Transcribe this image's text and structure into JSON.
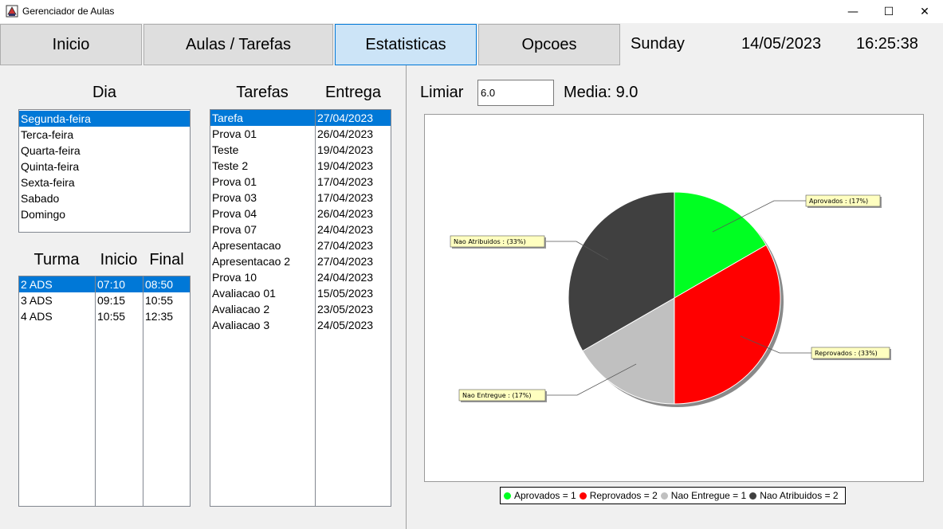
{
  "window": {
    "title": "Gerenciador de Aulas",
    "minimize": "—",
    "maximize": "☐",
    "close": "✕"
  },
  "nav": {
    "inicio": "Inicio",
    "aulas": "Aulas / Tarefas",
    "estatisticas": "Estatisticas",
    "opcoes": "Opcoes"
  },
  "status": {
    "day": "Sunday",
    "date": "14/05/2023",
    "time": "16:25:38"
  },
  "dia": {
    "header": "Dia",
    "items": [
      "Segunda-feira",
      "Terca-feira",
      "Quarta-feira",
      "Quinta-feira",
      "Sexta-feira",
      "Sabado",
      "Domingo"
    ],
    "selected": 0
  },
  "turmas": {
    "headers": {
      "turma": "Turma",
      "inicio": "Inicio",
      "final": "Final"
    },
    "rows": [
      {
        "turma": "2 ADS",
        "inicio": "07:10",
        "final": "08:50"
      },
      {
        "turma": "3 ADS",
        "inicio": "09:15",
        "final": "10:55"
      },
      {
        "turma": "4 ADS",
        "inicio": "10:55",
        "final": "12:35"
      }
    ],
    "selected": 0
  },
  "tarefas": {
    "headers": {
      "tarefa": "Tarefas",
      "entrega": "Entrega"
    },
    "rows": [
      {
        "nome": "Tarefa",
        "entrega": "27/04/2023"
      },
      {
        "nome": "Prova 01",
        "entrega": "26/04/2023"
      },
      {
        "nome": "Teste",
        "entrega": "19/04/2023"
      },
      {
        "nome": "Teste 2",
        "entrega": "19/04/2023"
      },
      {
        "nome": "Prova 01",
        "entrega": "17/04/2023"
      },
      {
        "nome": "Prova 03",
        "entrega": "17/04/2023"
      },
      {
        "nome": "Prova 04",
        "entrega": "26/04/2023"
      },
      {
        "nome": "Prova 07",
        "entrega": "24/04/2023"
      },
      {
        "nome": "Apresentacao",
        "entrega": "27/04/2023"
      },
      {
        "nome": "Apresentacao 2",
        "entrega": "27/04/2023"
      },
      {
        "nome": "Prova 10",
        "entrega": "24/04/2023"
      },
      {
        "nome": "Avaliacao 01",
        "entrega": "15/05/2023"
      },
      {
        "nome": "Avaliacao 2",
        "entrega": "23/05/2023"
      },
      {
        "nome": "Avaliacao 3",
        "entrega": "24/05/2023"
      }
    ],
    "selected": 0
  },
  "stats": {
    "limiar_label": "Limiar",
    "limiar_value": "6.0",
    "media": "Media: 9.0"
  },
  "colors": {
    "selection": "#0078d7",
    "aprovados": "#00ff22",
    "reprovados": "#ff0000",
    "nao_entregue": "#c0c0c0",
    "nao_atribuidos": "#404040"
  },
  "chart_data": {
    "type": "pie",
    "slices": [
      {
        "name": "Aprovados",
        "value": 1,
        "label": "Aprovados : (17%)",
        "legend": "Aprovados = 1",
        "color": "#00ff22"
      },
      {
        "name": "Reprovados",
        "value": 2,
        "label": "Reprovados : (33%)",
        "legend": "Reprovados = 2",
        "color": "#ff0000"
      },
      {
        "name": "Nao Entregue",
        "value": 1,
        "label": "Nao Entregue : (17%)",
        "legend": "Nao Entregue = 1",
        "color": "#c0c0c0"
      },
      {
        "name": "Nao Atribuidos",
        "value": 2,
        "label": "Nao Atribuidos : (33%)",
        "legend": "Nao Atribuidos = 2",
        "color": "#404040"
      }
    ],
    "legend_position": "bottom"
  }
}
